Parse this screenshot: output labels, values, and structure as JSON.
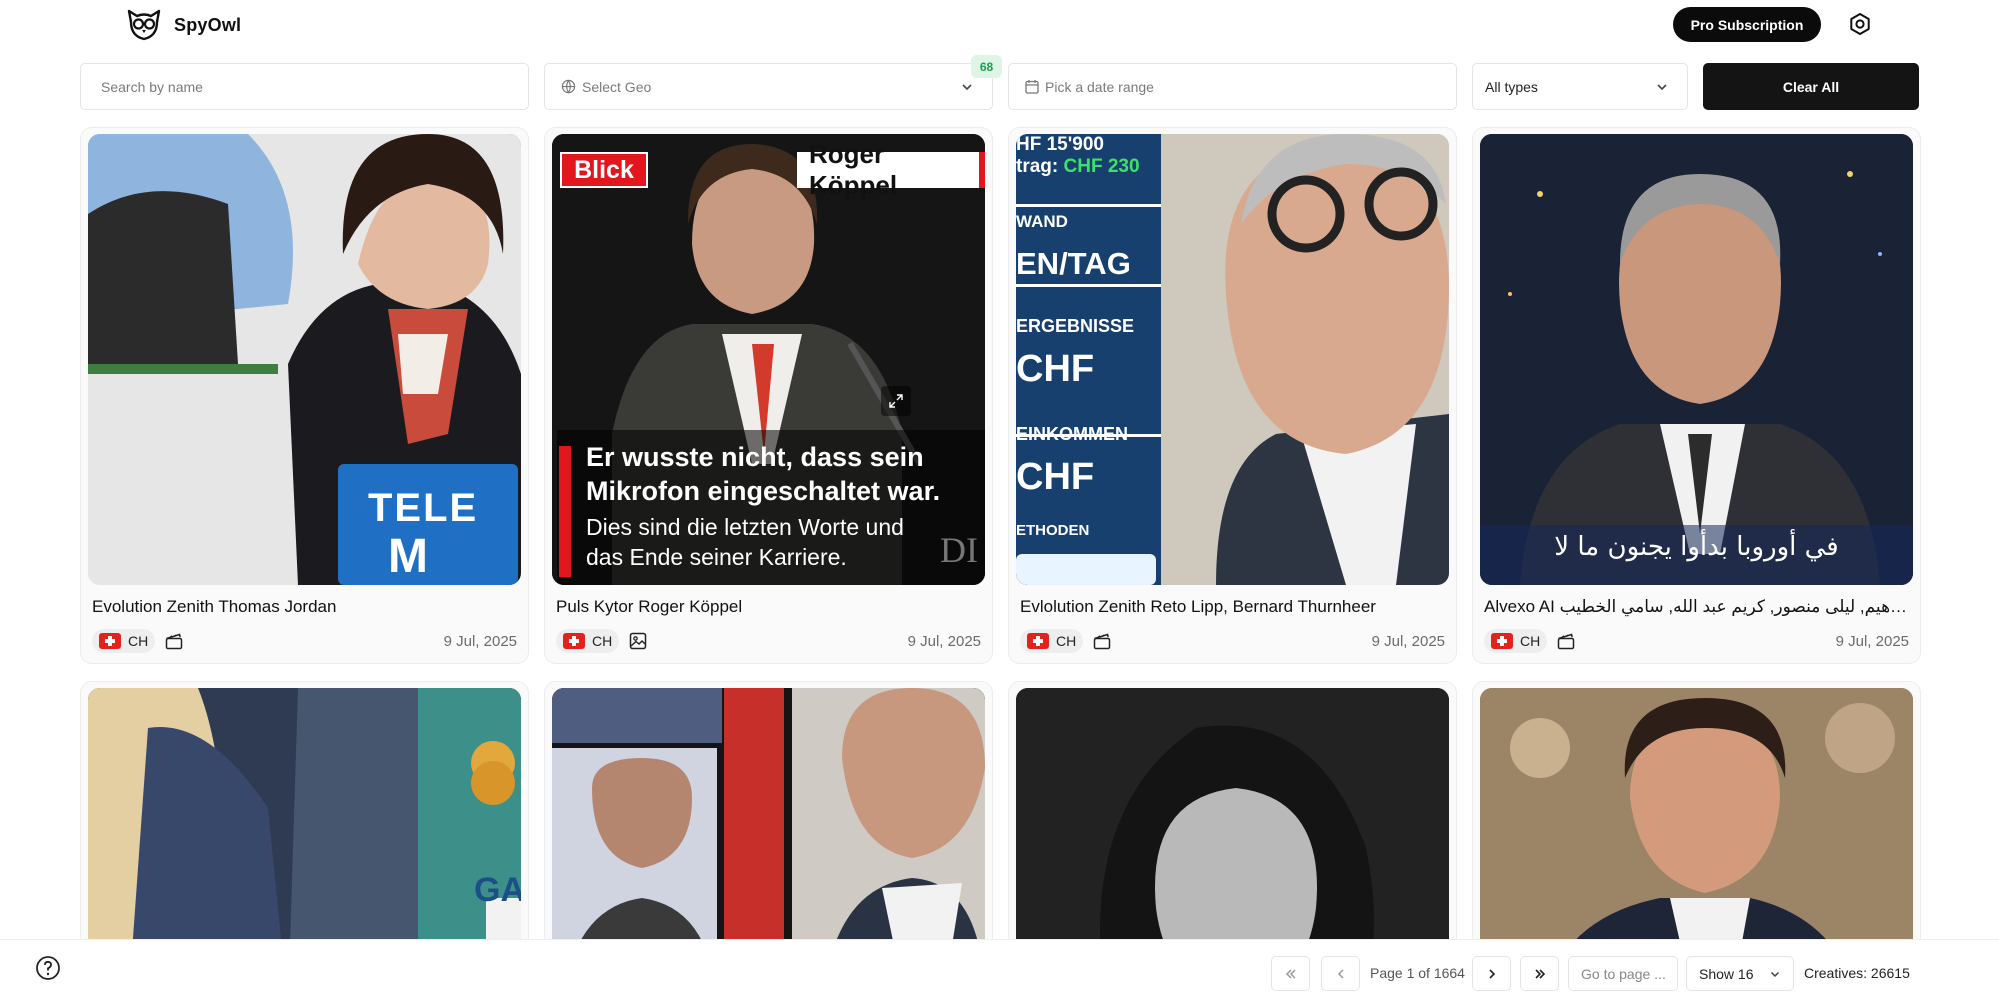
{
  "app": {
    "name": "SpyOwl"
  },
  "header": {
    "pro_label": "Pro Subscription"
  },
  "filters": {
    "search_placeholder": "Search by name",
    "geo_placeholder": "Select Geo",
    "geo_count": "68",
    "date_placeholder": "Pick a date range",
    "types_value": "All types",
    "clear_label": "Clear All"
  },
  "cards": [
    {
      "title": "Evolution Zenith Thomas Jordan",
      "geo": "CH",
      "type_icon": "video-icon",
      "date": "9 Jul, 2025"
    },
    {
      "title": "Puls Kytor Roger Köppel",
      "geo": "CH",
      "type_icon": "image-icon",
      "date": "9 Jul, 2025",
      "overlay": {
        "brand": "Blick",
        "name": "Roger Köppel",
        "headline1": "Er wusste nicht, dass sein",
        "headline2": "Mikrofon eingeschaltet war.",
        "sub1": "Dies sind die letzten Worte und",
        "sub2": "das Ende seiner Karriere.",
        "corner": "DI"
      }
    },
    {
      "title": "Evlolution Zenith Reto Lipp, Bernard Thurnheer",
      "geo": "CH",
      "type_icon": "video-icon",
      "date": "9 Jul, 2025",
      "overlay": {
        "l1": "HF 15'900",
        "l2a": "trag:",
        "l2b": "CHF 230",
        "l3": "WAND",
        "l4": "EN/TAG",
        "l5": "ERGEBNISSE",
        "l6": "CHF",
        "l7": "EINKOMMEN",
        "l8": "CHF",
        "l9": "ETHODEN"
      }
    },
    {
      "title": "Alvexo AI ف, علي إبراهيم, ليلى منصور, كريم عبد الله, سامي الخطيب...",
      "geo": "CH",
      "type_icon": "video-icon",
      "date": "9 Jul, 2025",
      "overlay": {
        "caption": "في أوروبا بدأوا يجنون ما لا"
      }
    },
    {
      "overlay": {
        "letters": "GA"
      }
    },
    {},
    {},
    {}
  ],
  "card1_overlay": {
    "tele": "TELE",
    "m": "M"
  },
  "pagination": {
    "page_text": "Page 1 of 1664",
    "goto_placeholder": "Go to page ...",
    "show_value": "Show 16",
    "creatives_label": "Creatives:",
    "creatives_count": "26615"
  },
  "colors": {
    "accent_dark": "#0b0b0b",
    "geo_badge_bg": "#dcf5e4",
    "geo_badge_fg": "#1f9d55",
    "flag_red": "#e2231a"
  }
}
